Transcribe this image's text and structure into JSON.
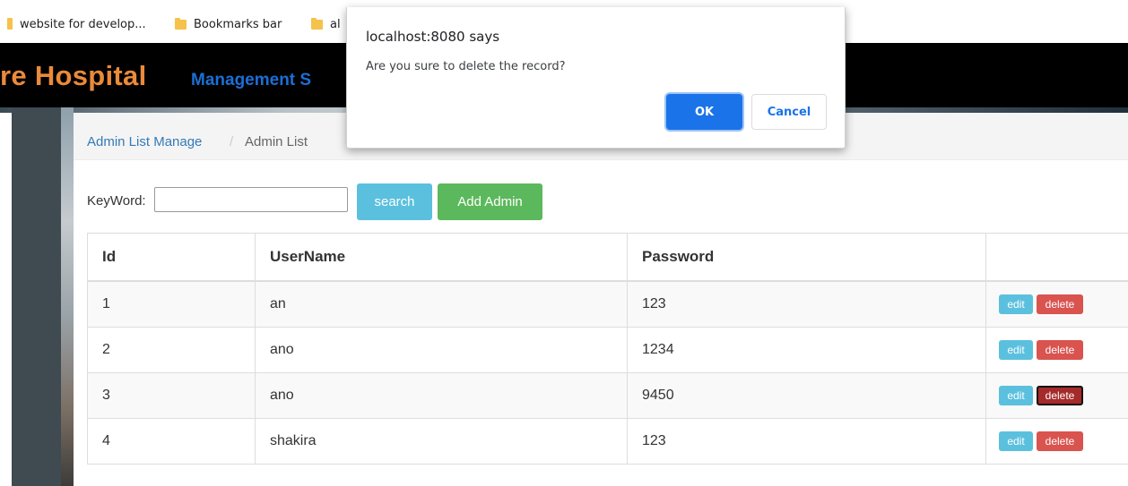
{
  "bookmarks": [
    {
      "label": "website for develop..."
    },
    {
      "label": "Bookmarks bar"
    },
    {
      "label": "al"
    }
  ],
  "header": {
    "brand_orange": "re Hospital",
    "brand_blue": "Management S"
  },
  "breadcrumb": {
    "link": "Admin List Manage",
    "separator": "/",
    "current": "Admin List"
  },
  "search": {
    "label": "KeyWord:",
    "value": "",
    "search_button": "search",
    "add_button": "Add Admin"
  },
  "table": {
    "columns": [
      "Id",
      "UserName",
      "Password",
      ""
    ],
    "rows": [
      {
        "id": "1",
        "username": "an",
        "password": "123",
        "edit": "edit",
        "delete": "delete"
      },
      {
        "id": "2",
        "username": "ano",
        "password": "1234",
        "edit": "edit",
        "delete": "delete"
      },
      {
        "id": "3",
        "username": "ano",
        "password": "9450",
        "edit": "edit",
        "delete": "delete"
      },
      {
        "id": "4",
        "username": "shakira",
        "password": "123",
        "edit": "edit",
        "delete": "delete"
      }
    ]
  },
  "dialog": {
    "title": "localhost:8080 says",
    "message": "Are you sure to delete the record?",
    "ok": "OK",
    "cancel": "Cancel"
  },
  "colors": {
    "brand_orange": "#ea8a3a",
    "brand_blue": "#1b6fd6",
    "info": "#5bc0de",
    "success": "#5cb85c",
    "danger": "#d9534f",
    "dialog_primary": "#1a73e8"
  },
  "icons": [
    "folder-icon"
  ]
}
